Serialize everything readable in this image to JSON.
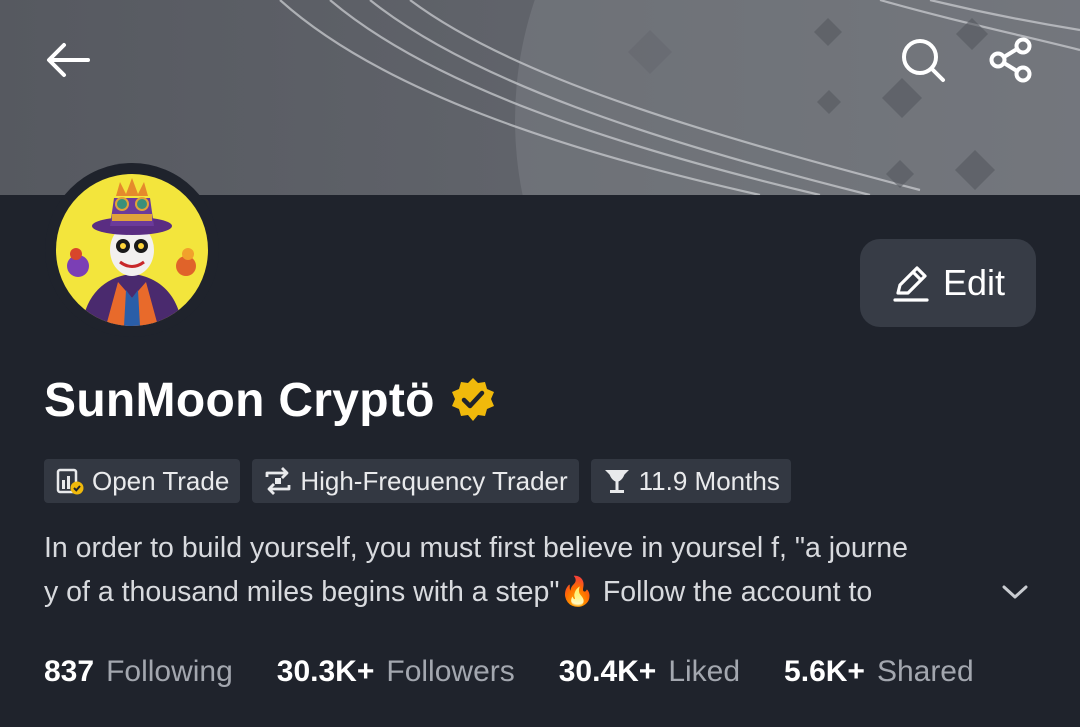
{
  "profile": {
    "name": "SunMoon Cryptö",
    "edit_label": "Edit",
    "tags": [
      {
        "icon": "open-trade-icon",
        "label": "Open Trade"
      },
      {
        "icon": "swap-arrows-icon",
        "label": "High-Frequency Trader"
      },
      {
        "icon": "trophy-icon",
        "label": "11.9 Months"
      }
    ],
    "bio": {
      "line1": "In order to build yourself, you must first believe in yoursel f, \"a journe",
      "line2": "y of a thousand miles begins with a step\"🔥 Follow the account to"
    },
    "stats": [
      {
        "value": "837",
        "label": "Following"
      },
      {
        "value": "30.3K+",
        "label": "Followers"
      },
      {
        "value": "30.4K+",
        "label": "Liked"
      },
      {
        "value": "5.6K+",
        "label": "Shared"
      }
    ]
  },
  "header": {
    "icons": [
      "back-arrow-icon",
      "search-icon",
      "share-icon"
    ]
  },
  "colors": {
    "background": "#1f232c",
    "cover": "#5f6269",
    "edit_button": "#373c46",
    "tag_background": "#333842",
    "verified_badge": "#f0b90b",
    "muted_text": "#a3a7af"
  }
}
